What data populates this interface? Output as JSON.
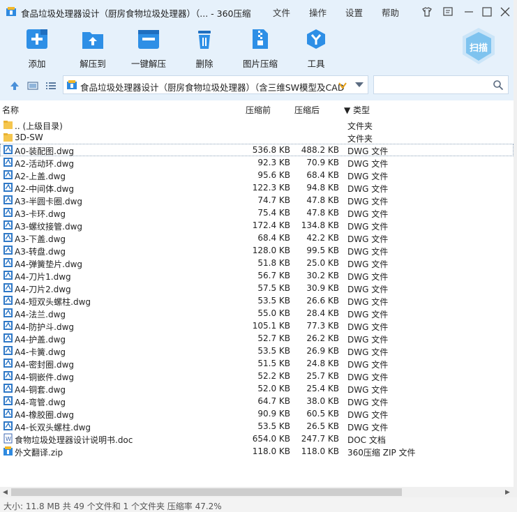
{
  "window": {
    "title": "食品垃圾处理器设计（厨房食物垃圾处理器）（... - 360压缩",
    "menu": [
      "文件",
      "操作",
      "设置",
      "帮助"
    ]
  },
  "toolbar": {
    "buttons": [
      {
        "label": "添加",
        "icon": "add-icon"
      },
      {
        "label": "解压到",
        "icon": "extract-to-icon"
      },
      {
        "label": "一键解压",
        "icon": "one-click-extract-icon"
      },
      {
        "label": "删除",
        "icon": "delete-icon"
      },
      {
        "label": "图片压缩",
        "icon": "image-compress-icon"
      },
      {
        "label": "工具",
        "icon": "tools-icon"
      }
    ],
    "scan_label": "扫描"
  },
  "address": {
    "path": "食品垃圾处理器设计（厨房食物垃圾处理器）（含三维SW模型及CAD"
  },
  "columns": {
    "name": "名称",
    "before": "压缩前",
    "after": "压缩后",
    "type": "▼ 类型"
  },
  "files": [
    {
      "name": ".. (上级目录)",
      "before": "",
      "after": "",
      "type": "文件夹",
      "kind": "folder"
    },
    {
      "name": "3D-SW",
      "before": "",
      "after": "",
      "type": "文件夹",
      "kind": "folder"
    },
    {
      "name": "A0-装配图.dwg",
      "before": "536.8 KB",
      "after": "488.2 KB",
      "type": "DWG 文件",
      "kind": "dwg"
    },
    {
      "name": "A2-活动环.dwg",
      "before": "92.3 KB",
      "after": "70.9 KB",
      "type": "DWG 文件",
      "kind": "dwg"
    },
    {
      "name": "A2-上盖.dwg",
      "before": "95.6 KB",
      "after": "68.4 KB",
      "type": "DWG 文件",
      "kind": "dwg"
    },
    {
      "name": "A2-中间体.dwg",
      "before": "122.3 KB",
      "after": "94.8 KB",
      "type": "DWG 文件",
      "kind": "dwg"
    },
    {
      "name": "A3-半圆卡圈.dwg",
      "before": "74.7 KB",
      "after": "47.8 KB",
      "type": "DWG 文件",
      "kind": "dwg"
    },
    {
      "name": "A3-卡环.dwg",
      "before": "75.4 KB",
      "after": "47.8 KB",
      "type": "DWG 文件",
      "kind": "dwg"
    },
    {
      "name": "A3-螺纹接管.dwg",
      "before": "172.4 KB",
      "after": "134.8 KB",
      "type": "DWG 文件",
      "kind": "dwg"
    },
    {
      "name": "A3-下盖.dwg",
      "before": "68.4 KB",
      "after": "42.2 KB",
      "type": "DWG 文件",
      "kind": "dwg"
    },
    {
      "name": "A3-转盘.dwg",
      "before": "128.0 KB",
      "after": "99.5 KB",
      "type": "DWG 文件",
      "kind": "dwg"
    },
    {
      "name": "A4-弹簧垫片.dwg",
      "before": "51.8 KB",
      "after": "25.0 KB",
      "type": "DWG 文件",
      "kind": "dwg"
    },
    {
      "name": "A4-刀片1.dwg",
      "before": "56.7 KB",
      "after": "30.2 KB",
      "type": "DWG 文件",
      "kind": "dwg"
    },
    {
      "name": "A4-刀片2.dwg",
      "before": "57.5 KB",
      "after": "30.9 KB",
      "type": "DWG 文件",
      "kind": "dwg"
    },
    {
      "name": "A4-短双头螺柱.dwg",
      "before": "53.5 KB",
      "after": "26.6 KB",
      "type": "DWG 文件",
      "kind": "dwg"
    },
    {
      "name": "A4-法兰.dwg",
      "before": "55.0 KB",
      "after": "28.4 KB",
      "type": "DWG 文件",
      "kind": "dwg"
    },
    {
      "name": "A4-防护斗.dwg",
      "before": "105.1 KB",
      "after": "77.3 KB",
      "type": "DWG 文件",
      "kind": "dwg"
    },
    {
      "name": "A4-护盖.dwg",
      "before": "52.7 KB",
      "after": "26.2 KB",
      "type": "DWG 文件",
      "kind": "dwg"
    },
    {
      "name": "A4-卡簧.dwg",
      "before": "53.5 KB",
      "after": "26.9 KB",
      "type": "DWG 文件",
      "kind": "dwg"
    },
    {
      "name": "A4-密封圈.dwg",
      "before": "51.5 KB",
      "after": "24.8 KB",
      "type": "DWG 文件",
      "kind": "dwg"
    },
    {
      "name": "A4-铜嵌件.dwg",
      "before": "52.2 KB",
      "after": "25.7 KB",
      "type": "DWG 文件",
      "kind": "dwg"
    },
    {
      "name": "A4-铜套.dwg",
      "before": "52.0 KB",
      "after": "25.4 KB",
      "type": "DWG 文件",
      "kind": "dwg"
    },
    {
      "name": "A4-弯管.dwg",
      "before": "64.7 KB",
      "after": "38.0 KB",
      "type": "DWG 文件",
      "kind": "dwg"
    },
    {
      "name": "A4-橡胶圈.dwg",
      "before": "90.9 KB",
      "after": "60.5 KB",
      "type": "DWG 文件",
      "kind": "dwg"
    },
    {
      "name": "A4-长双头螺柱.dwg",
      "before": "53.5 KB",
      "after": "26.5 KB",
      "type": "DWG 文件",
      "kind": "dwg"
    },
    {
      "name": "食物垃圾处理器设计说明书.doc",
      "before": "654.0 KB",
      "after": "247.7 KB",
      "type": "DOC 文档",
      "kind": "doc"
    },
    {
      "name": "外文翻译.zip",
      "before": "118.0 KB",
      "after": "118.0 KB",
      "type": "360压缩 ZIP 文件",
      "kind": "zip"
    }
  ],
  "status": {
    "text": "大小: 11.8 MB 共 49 个文件和 1 个文件夹 压缩率 47.2%"
  }
}
